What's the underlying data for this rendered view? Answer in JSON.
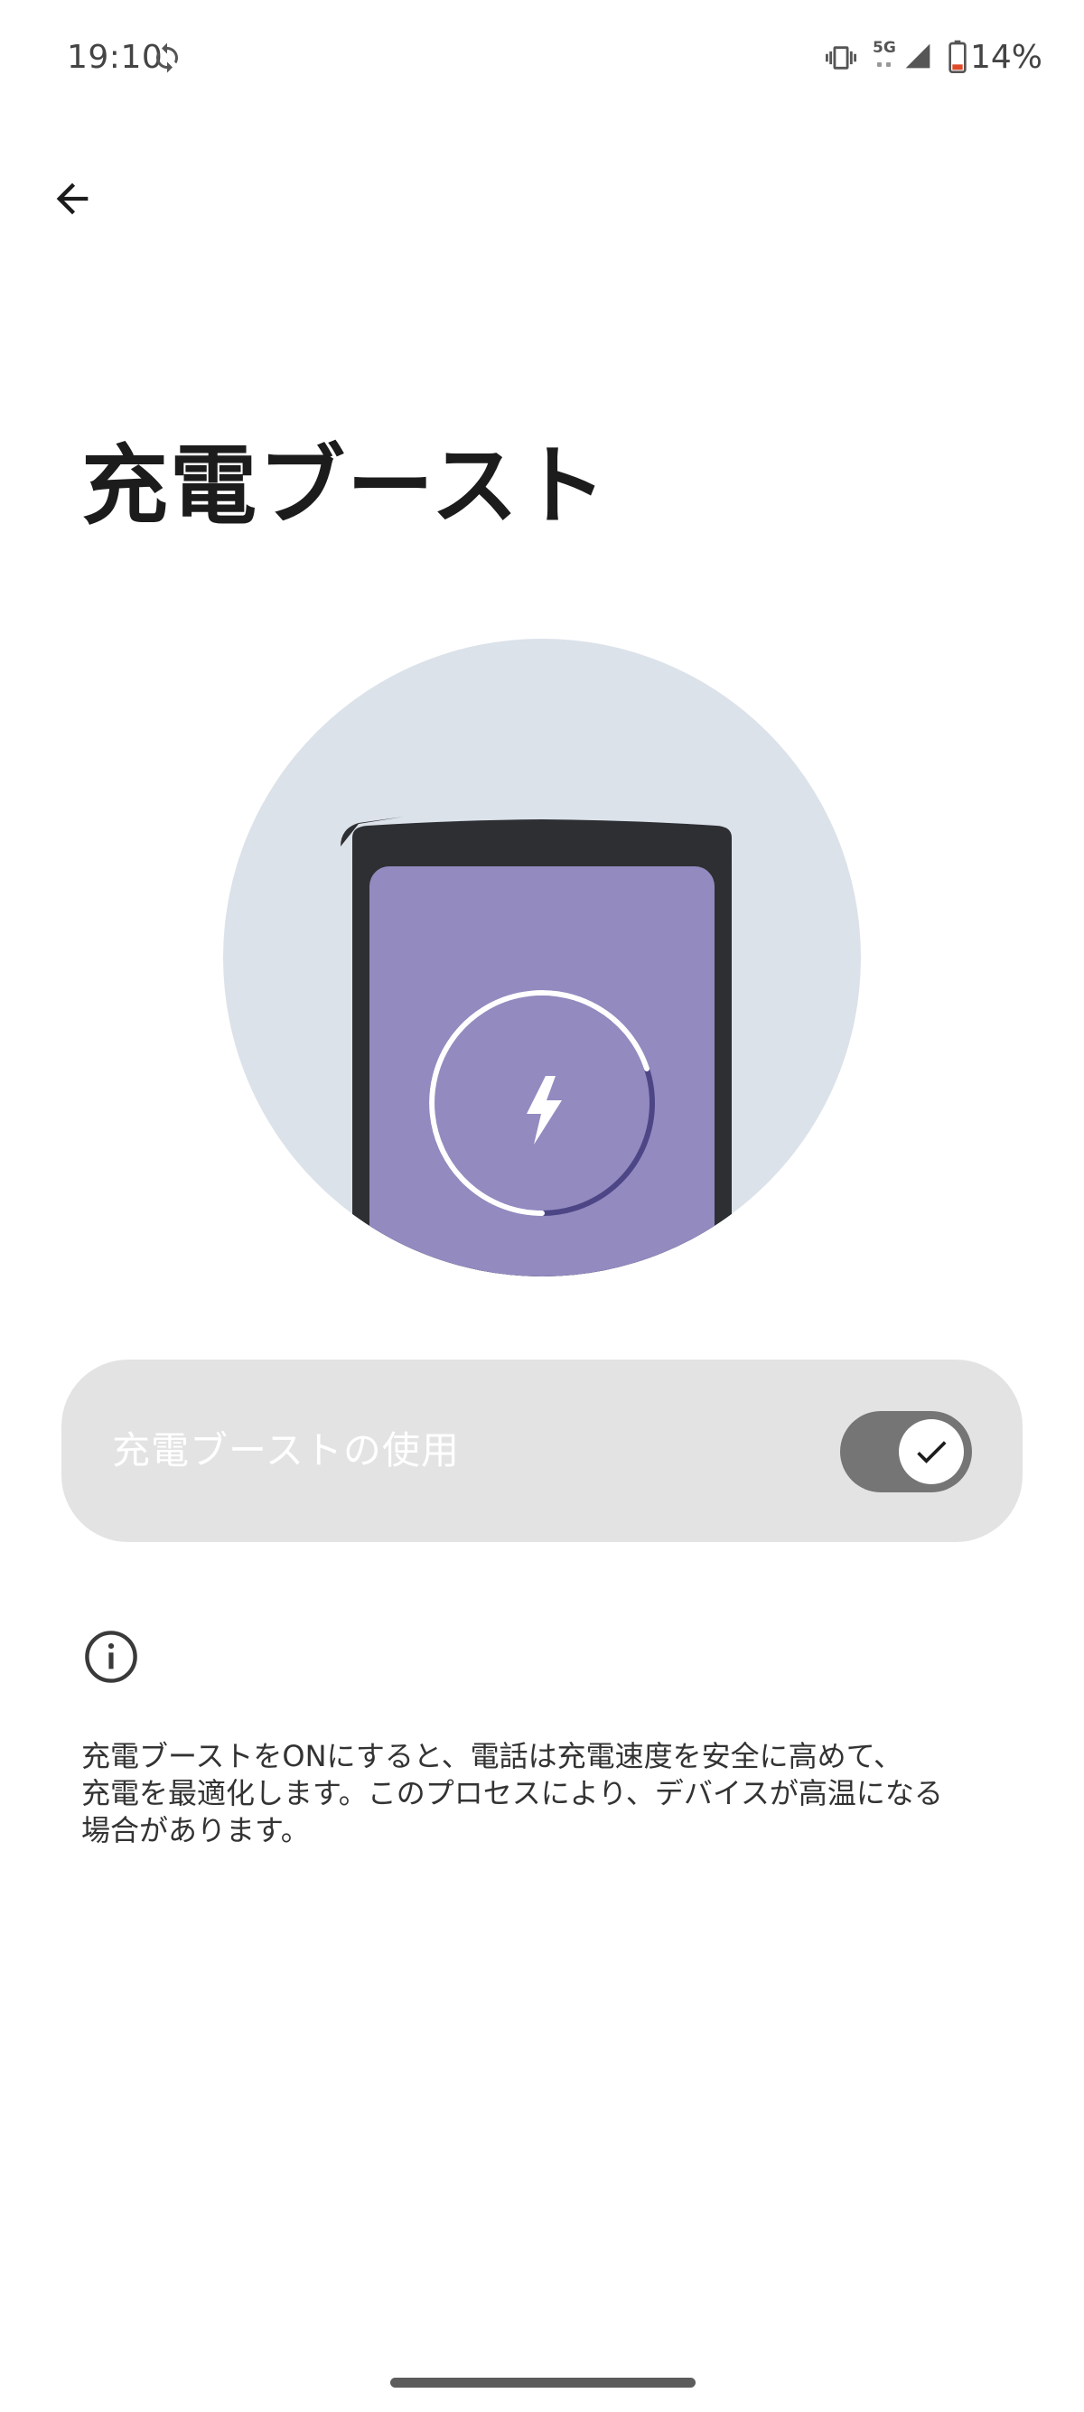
{
  "status_bar": {
    "time": "19:10",
    "network": "5G",
    "battery": "14%"
  },
  "header": {
    "back_icon": "arrow-back-icon"
  },
  "page": {
    "title": "充電ブースト"
  },
  "illustration": {
    "icon": "charging-phone-illustration",
    "colors": {
      "circle_bg": "#dce2ea",
      "phone_frame": "#2d2f33",
      "screen": "#938ac0",
      "ring_dark": "#4d4686"
    }
  },
  "toggle": {
    "label": "充電ブーストの使用",
    "checked": true,
    "track_color": "#757575"
  },
  "info": {
    "icon": "info-icon",
    "text": "充電ブーストをONにすると、電話は充電速度を安全に高めて、\n充電を最適化します。このプロセスにより、デバイスが高温になる\n場合があります。"
  }
}
